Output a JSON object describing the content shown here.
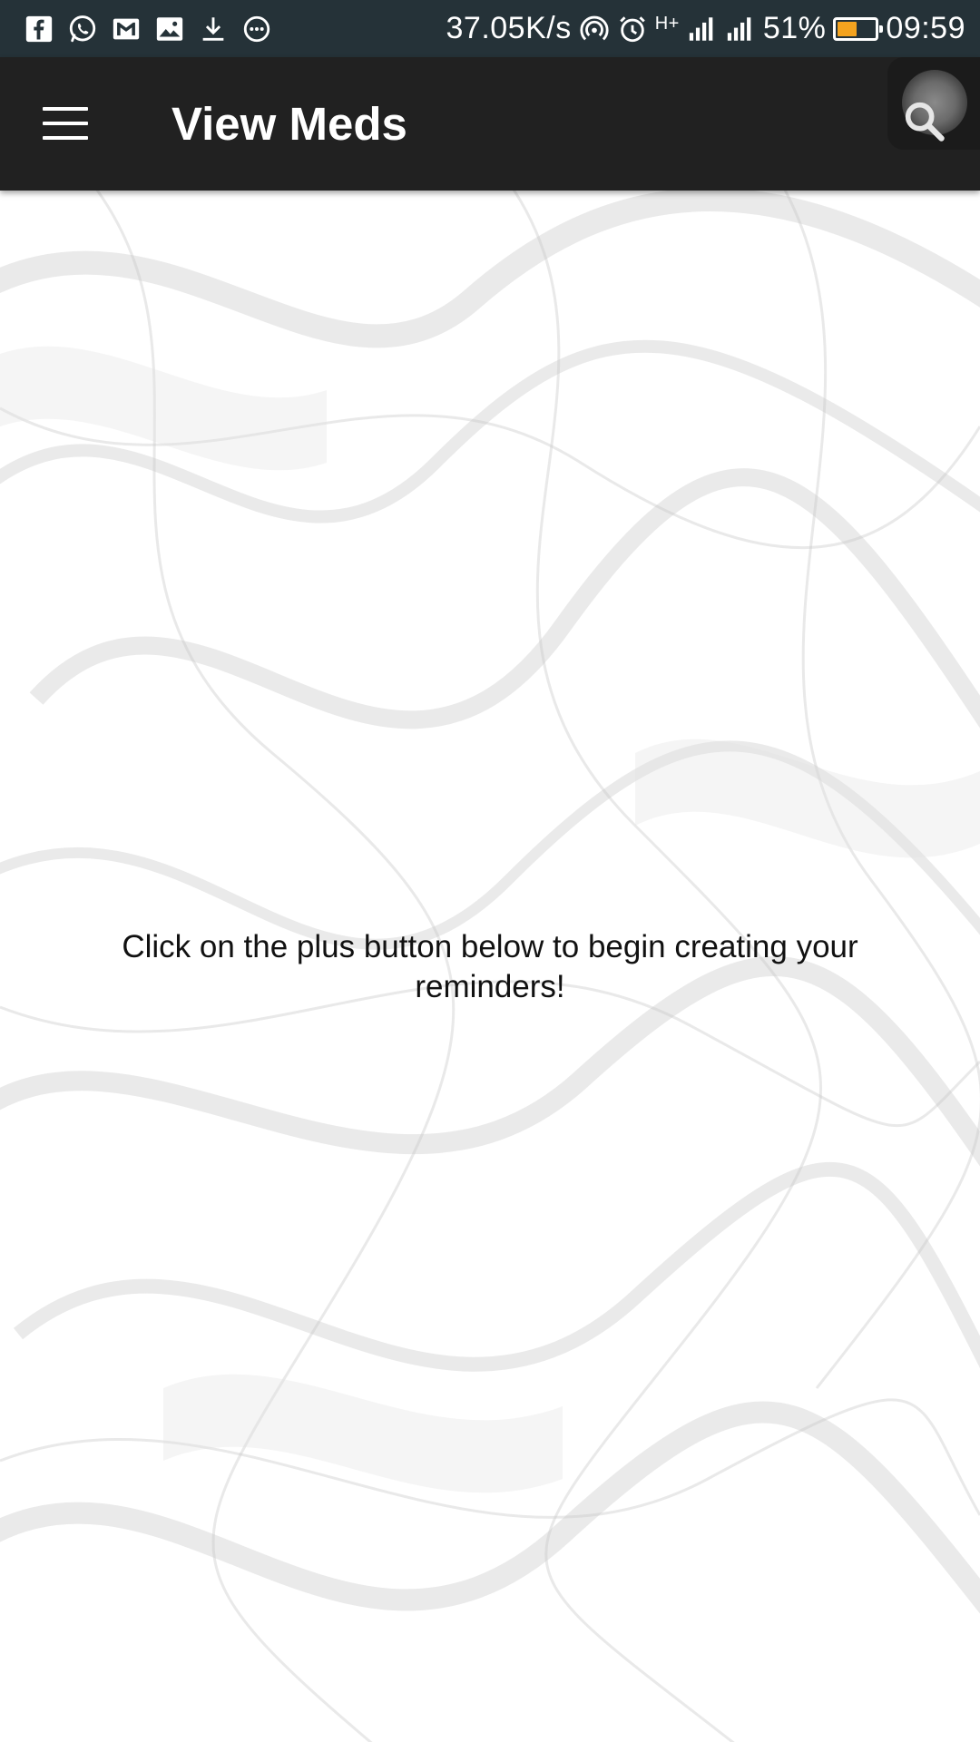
{
  "status_bar": {
    "network_speed": "37.05K/s",
    "network_type": "H+",
    "battery_percent": "51%",
    "battery_level": 0.51,
    "battery_color": "#f4a31f",
    "time": "09:59",
    "notification_icons": [
      "facebook-icon",
      "whatsapp-icon",
      "gmail-icon",
      "gallery-icon",
      "download-icon",
      "more-icon"
    ],
    "system_icons": [
      "hotspot-icon",
      "alarm-icon",
      "signal-icon",
      "signal-icon",
      "battery-icon"
    ]
  },
  "app_bar": {
    "title": "View Meds",
    "background": "#212121",
    "menu_icon": "hamburger-menu-icon",
    "action_icon": "search-icon"
  },
  "main": {
    "empty_message": "Click on the plus button below to begin creating your reminders!"
  }
}
